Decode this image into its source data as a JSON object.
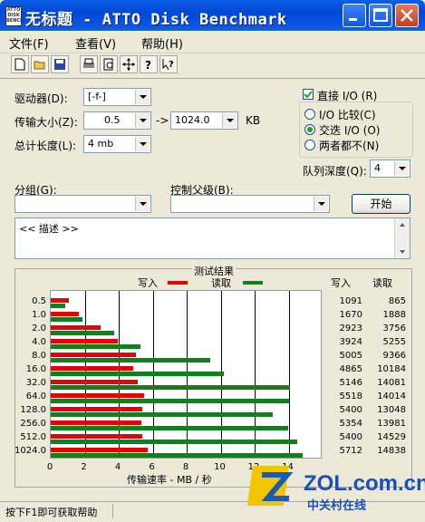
{
  "window": {
    "title": "无标题 - ATTO Disk Benchmark",
    "icon_text": "ATTO DISK BENCH",
    "controls": [
      "minimize-icon",
      "maximize-icon",
      "close-icon"
    ]
  },
  "menu": [
    "文件(F)",
    "查看(V)",
    "帮助(H)"
  ],
  "toolbar": [
    "new-file-icon",
    "open-folder-icon",
    "save-icon",
    "print-icon",
    "print-preview-icon",
    "move-icon",
    "help-icon",
    "context-help-icon"
  ],
  "drive": {
    "label": "驱动器(D):",
    "value": "[-f-]"
  },
  "transfer": {
    "label": "传输大小(Z):",
    "from": "0.5",
    "to_label": "-> ",
    "to": "1024.0",
    "unit": "KB"
  },
  "total": {
    "label": "总计长度(L):",
    "value": "4 mb"
  },
  "direct_io": {
    "label": "直接 I/O (R)",
    "checked": true
  },
  "io_mode": {
    "options": [
      "I/O 比较(C)",
      "交迭 I/O (O)",
      "两者都不(N)"
    ],
    "selected": 1
  },
  "queue": {
    "label": "队列深度(Q):",
    "value": "4"
  },
  "group": {
    "label": "分组(G):",
    "value": ""
  },
  "control": {
    "label": "控制父级(B):",
    "value": ""
  },
  "start_button": "开始",
  "description": {
    "text": "<< 描述 >>"
  },
  "results": {
    "title": "测试结果",
    "legend_write": "写入",
    "legend_read": "读取",
    "col_write": "写入",
    "col_read": "读取",
    "xlabel": "传输速率 - MB / 秒"
  },
  "chart_data": {
    "type": "bar",
    "orientation": "horizontal",
    "categories": [
      "0.5",
      "1.0",
      "2.0",
      "4.0",
      "8.0",
      "16.0",
      "32.0",
      "64.0",
      "128.0",
      "256.0",
      "512.0",
      "1024.0"
    ],
    "series": [
      {
        "name": "写入",
        "color": "#e60000",
        "values": [
          1091,
          1670,
          2923,
          3924,
          5005,
          4865,
          5146,
          5518,
          5400,
          5354,
          5400,
          5712
        ]
      },
      {
        "name": "读取",
        "color": "#10801a",
        "values": [
          865,
          1888,
          3756,
          5255,
          9366,
          10184,
          14081,
          14014,
          13048,
          13981,
          14529,
          14838
        ]
      }
    ],
    "xlabel": "传输速率 - MB / 秒",
    "xticks": [
      "0",
      "2",
      "4",
      "6",
      "8",
      "10",
      "12",
      "14"
    ],
    "xlim": [
      0,
      16
    ],
    "value_unit_note": "KB/s"
  },
  "status": "按下F1即可获取帮助",
  "watermark": {
    "main": "ZOL.com.cn",
    "sub": "中关村在线"
  }
}
